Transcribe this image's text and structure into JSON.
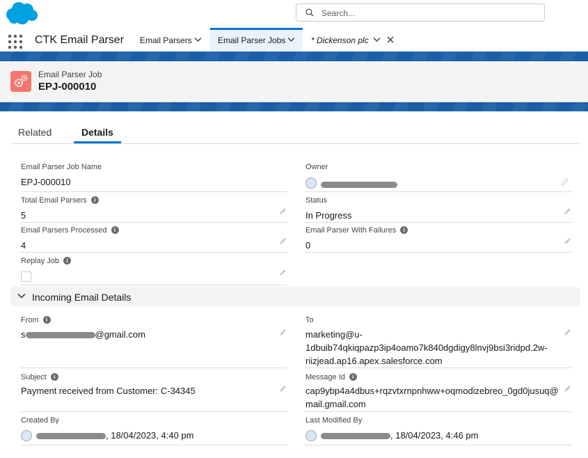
{
  "header": {
    "logo": "cloud-logo",
    "search_placeholder": "Search..."
  },
  "nav": {
    "app_name": "CTK Email Parser",
    "tabs": [
      {
        "label": "Email Parsers",
        "active": false
      },
      {
        "label": "Email Parser Jobs",
        "active": true
      },
      {
        "label": "* Dickenson plc",
        "active": false,
        "italic": true,
        "closable": true
      }
    ]
  },
  "record": {
    "object_type": "Email Parser Job",
    "name": "EPJ-000010",
    "icon": "gears-icon"
  },
  "record_tabs": [
    "Related",
    "Details"
  ],
  "active_record_tab": "Details",
  "fields": {
    "job_name": {
      "label": "Email Parser Job Name",
      "value": "EPJ-000010"
    },
    "owner": {
      "label": "Owner"
    },
    "total": {
      "label": "Total Email Parsers",
      "value": "5"
    },
    "status": {
      "label": "Status",
      "value": "In Progress"
    },
    "processed": {
      "label": "Email Parsers Processed",
      "value": "4"
    },
    "failures": {
      "label": "Email Parser With Failures",
      "value": "0"
    },
    "replay": {
      "label": "Replay Job",
      "checked": false
    }
  },
  "section": {
    "title": "Incoming Email Details",
    "from": {
      "label": "From",
      "value_prefix": "s",
      "value_suffix": "@gmail.com"
    },
    "to": {
      "label": "To",
      "lines": [
        "marketing@u-",
        "1dbuib74qkiqpazp3ip4oamo7k840dgdigy8lnvj9bsi3ridpd.2w-",
        "riizjead.ap16.apex.salesforce.com"
      ]
    },
    "subject": {
      "label": "Subject",
      "value": "Payment received from Customer: C-34345"
    },
    "message_id": {
      "label": "Message Id",
      "lines": [
        "cap9ybp4a4dbus+rqzvtxrnpnhww+oqmodizebreo_0gd0jusuq@",
        "mail.gmail.com"
      ]
    },
    "created_by": {
      "label": "Created By",
      "date": ", 18/04/2023, 4:40 pm"
    },
    "modified_by": {
      "label": "Last Modified By",
      "date": ", 18/04/2023, 4:46 pm"
    }
  },
  "colors": {
    "brand": "#0176d3",
    "band": "#1b5fa8",
    "object_icon": "#f2766b",
    "link": "#0b5cab"
  }
}
